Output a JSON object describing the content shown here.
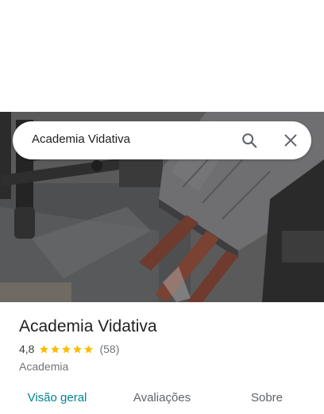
{
  "search": {
    "query": "Academia Vidativa"
  },
  "place": {
    "name": "Academia Vidativa",
    "rating": "4,8",
    "stars": 5,
    "review_count": "(58)",
    "category": "Academia"
  },
  "tabs": [
    {
      "label": "Visão geral",
      "active": true
    },
    {
      "label": "Avaliações",
      "active": false
    },
    {
      "label": "Sobre",
      "active": false
    }
  ],
  "colors": {
    "accent": "#00838f",
    "star": "#fbbc04"
  },
  "icons": {
    "search": "search-icon",
    "close": "close-icon",
    "star": "star-icon"
  }
}
